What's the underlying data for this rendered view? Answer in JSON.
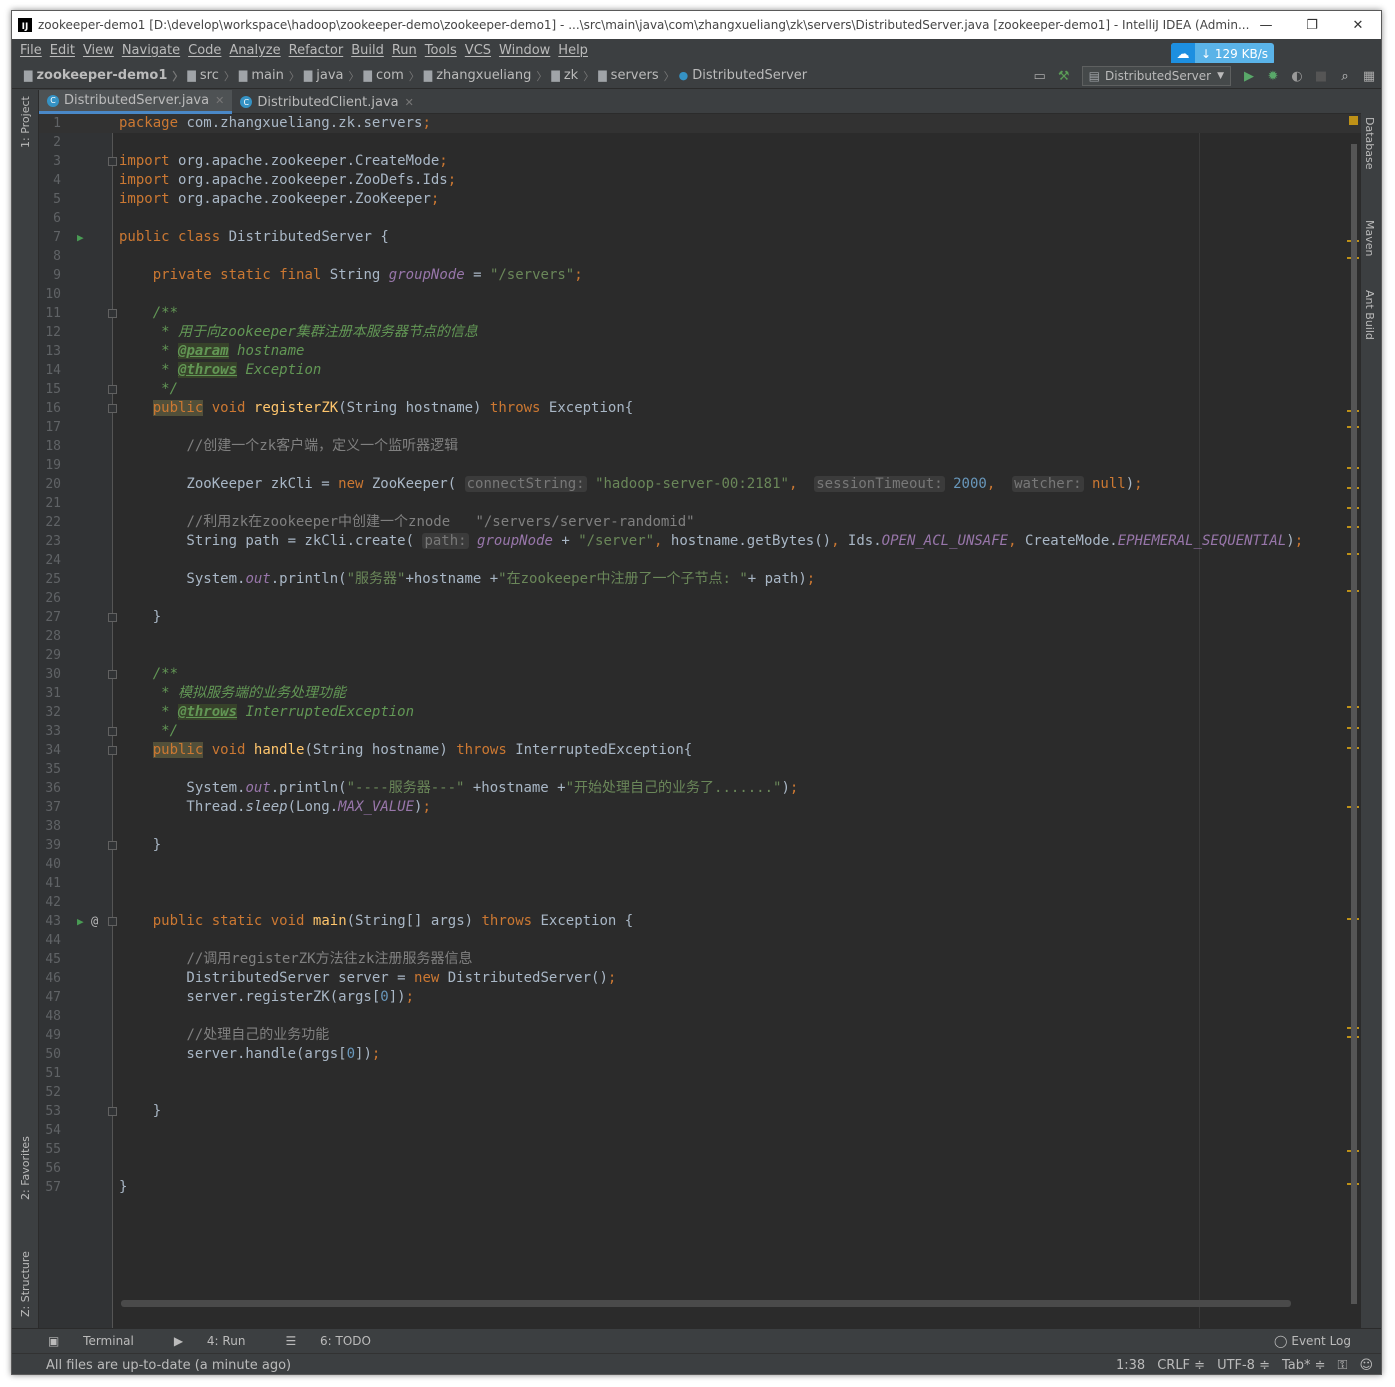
{
  "window": {
    "title": "zookeeper-demo1 [D:\\develop\\workspace\\hadoop\\zookeeper-demo\\zookeeper-demo1] - ...\\src\\main\\java\\com\\zhangxueliang\\zk\\servers\\DistributedServer.java [zookeeper-demo1] - IntelliJ IDEA (Admin...",
    "logo": "IJ",
    "minimize": "—",
    "restore": "❐",
    "close": "✕"
  },
  "menu": [
    "File",
    "Edit",
    "View",
    "Navigate",
    "Code",
    "Analyze",
    "Refactor",
    "Build",
    "Run",
    "Tools",
    "VCS",
    "Window",
    "Help"
  ],
  "speed": {
    "label": "↓ 129 KB/s",
    "icon": "cloud-icon"
  },
  "breadcrumb": [
    {
      "label": "zookeeper-demo1",
      "bold": true
    },
    {
      "label": "src"
    },
    {
      "label": "main"
    },
    {
      "label": "java"
    },
    {
      "label": "com"
    },
    {
      "label": "zhangxueliang"
    },
    {
      "label": "zk"
    },
    {
      "label": "servers"
    },
    {
      "label": "DistributedServer"
    }
  ],
  "run_config": "DistributedServer",
  "tabs": [
    {
      "label": "DistributedServer.java",
      "active": true
    },
    {
      "label": "DistributedClient.java",
      "active": false
    }
  ],
  "left_tools": [
    "1: Project",
    "2: Favorites",
    "Z: Structure"
  ],
  "right_tools": [
    "Database",
    "Maven",
    "Ant Build"
  ],
  "code_lines": [
    "package com.zhangxueliang.zk.servers;",
    "",
    "import org.apache.zookeeper.CreateMode;",
    "import org.apache.zookeeper.ZooDefs.Ids;",
    "import org.apache.zookeeper.ZooKeeper;",
    "",
    "public class DistributedServer {",
    "",
    "    private static final String groupNode = \"/servers\";",
    "",
    "    /**",
    "     * 用于向zookeeper集群注册本服务器节点的信息",
    "     * @param hostname",
    "     * @throws Exception",
    "     */",
    "    public void registerZK(String hostname) throws Exception{",
    "",
    "        //创建一个zk客户端，定义一个监听器逻辑",
    "",
    "        ZooKeeper zkCli = new ZooKeeper( connectString: \"hadoop-server-00:2181\",  sessionTimeout: 2000,  watcher: null);",
    "",
    "        //利用zk在zookeeper中创建一个znode   \"/servers/server-randomid\"",
    "        String path = zkCli.create( path: groupNode + \"/server\", hostname.getBytes(), Ids.OPEN_ACL_UNSAFE, CreateMode.EPHEMERAL_SEQUENTIAL);",
    "",
    "        System.out.println(\"服务器\"+hostname +\"在zookeeper中注册了一个子节点: \"+ path);",
    "",
    "    }",
    "",
    "",
    "    /**",
    "     * 模拟服务端的业务处理功能",
    "     * @throws InterruptedException",
    "     */",
    "    public void handle(String hostname) throws InterruptedException{",
    "",
    "        System.out.println(\"----服务器---\" +hostname +\"开始处理自己的业务了.......\");",
    "        Thread.sleep(Long.MAX_VALUE);",
    "",
    "    }",
    "",
    "",
    "",
    "    public static void main(String[] args) throws Exception {",
    "",
    "        //调用registerZK方法往zk注册服务器信息",
    "        DistributedServer server = new DistributedServer();",
    "        server.registerZK(args[0]);",
    "",
    "        //处理自己的业务功能",
    "        server.handle(args[0]);",
    "",
    "",
    "    }",
    "",
    "",
    "",
    "}"
  ],
  "bottom_tools": [
    "Terminal",
    "4: Run",
    "6: TODO"
  ],
  "event_log": "Event Log",
  "status": {
    "message": "All files are up-to-date (a minute ago)",
    "position": "1:38",
    "line_sep": "CRLF ≑",
    "encoding": "UTF-8 ≑",
    "indent": "Tab* ≑"
  },
  "colors": {
    "keyword": "#cc7832",
    "string": "#6a8759",
    "number": "#6897bb",
    "comment": "#808080",
    "doc": "#629755",
    "field": "#9876aa",
    "method": "#ffc66d",
    "editor_bg": "#2b2b2b"
  }
}
